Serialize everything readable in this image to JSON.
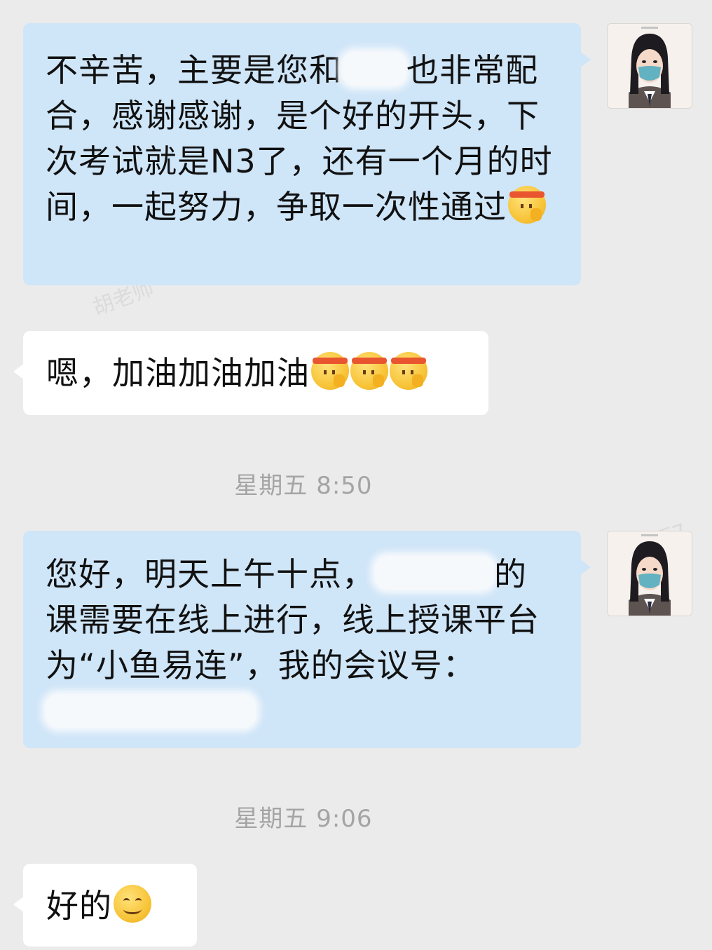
{
  "messages": [
    {
      "side": "sent",
      "text_before_redaction": "不辛苦，主要是您和",
      "text_after_redaction": "也非常配合，感谢感谢，是个好的开头，下次考试就是N3了，还有一个月的时间，一起努力，争取一次性通过",
      "emoji": "determined-face-emoji"
    },
    {
      "side": "received",
      "text": "嗯，加油加油加油",
      "emoji": "determined-face-emoji"
    },
    {
      "side": "sent",
      "text_before_redaction": "您好，明天上午十点，",
      "text_after_redaction": "的课需要在线上进行，线上授课平台为“小鱼易连”，我的会议号："
    },
    {
      "side": "received",
      "text": "好的",
      "emoji": "smiling-face-emoji"
    }
  ],
  "timestamps": [
    "星期五 8:50",
    "星期五 9:06"
  ],
  "avatar": {
    "icon": "teacher-avatar-masked-girl"
  },
  "colors": {
    "background": "#ebebeb",
    "sent_bubble": "#cfe5f8",
    "received_bubble": "#ffffff",
    "timestamp_text": "#a4a4a4"
  }
}
